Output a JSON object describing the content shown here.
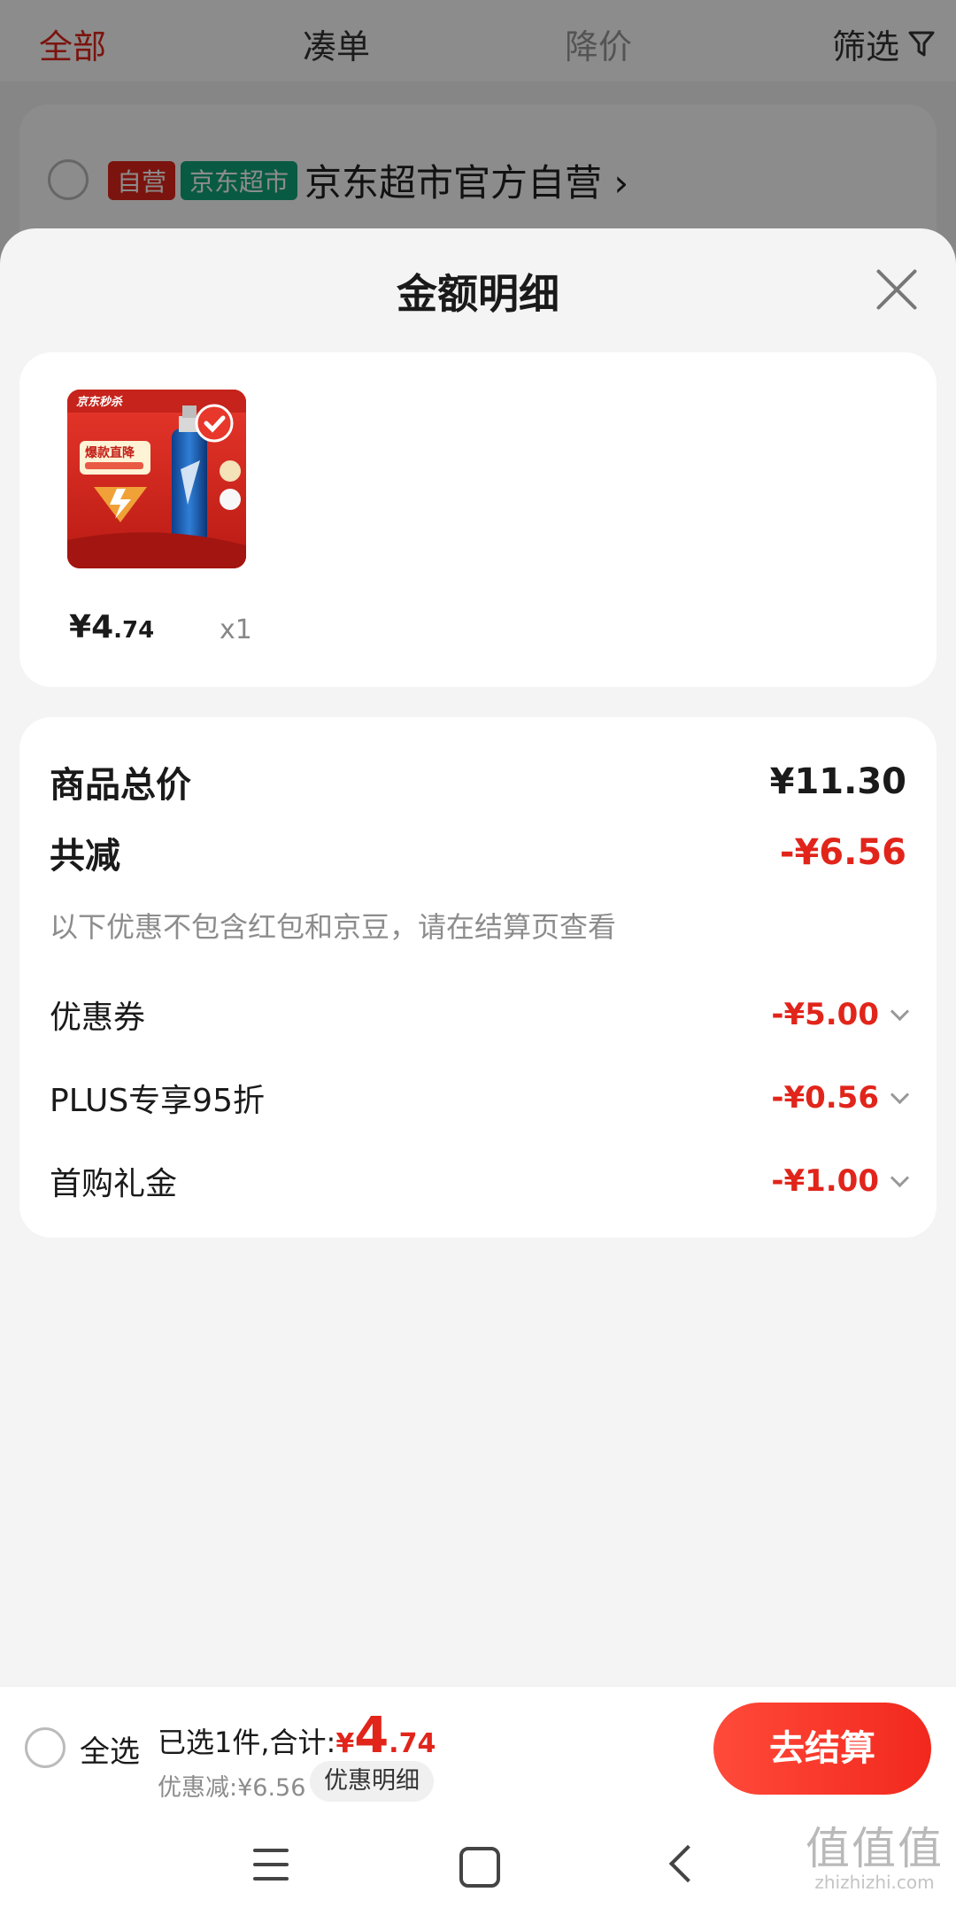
{
  "tabs": [
    {
      "label": "全部",
      "state": "active"
    },
    {
      "label": "凑单",
      "state": "normal"
    },
    {
      "label": "降价",
      "state": "faded"
    }
  ],
  "filter": {
    "label": "筛选",
    "icon": "funnel-icon"
  },
  "store": {
    "badge_self": "自营",
    "badge_supermarket": "京东超市",
    "name": "京东超市官方自营",
    "chevron": "›"
  },
  "sheet": {
    "title": "金额明细",
    "close_icon": "close-icon"
  },
  "product": {
    "price_symbol": "¥",
    "price_int": "4",
    "price_dec": ".74",
    "quantity": "x1",
    "image_text": [
      "京东秒杀",
      "爆款直降"
    ]
  },
  "summary": {
    "total_label": "商品总价",
    "total_value": "¥11.30",
    "reduce_label": "共减",
    "reduce_value": "-¥6.56",
    "note": "以下优惠不包含红包和京豆，请在结算页查看",
    "items": [
      {
        "label": "优惠券",
        "value": "-¥5.00"
      },
      {
        "label": "PLUS专享95折",
        "value": "-¥0.56"
      },
      {
        "label": "首购礼金",
        "value": "-¥1.00"
      }
    ]
  },
  "bottom_bar": {
    "select_all": "全选",
    "selected_text": "已选1件,合计:",
    "total_symbol": "¥",
    "total_int": "4",
    "total_dec": ".74",
    "discount_text": "优惠减:¥6.56",
    "detail_chip": "优惠明细",
    "checkout": "去结算"
  },
  "watermark": {
    "big": "值值值",
    "small": "zhizhizhi.com"
  },
  "colors": {
    "accent_red": "#e1251b",
    "supermarket_green": "#12a57a",
    "background": "#f4f4f4"
  }
}
